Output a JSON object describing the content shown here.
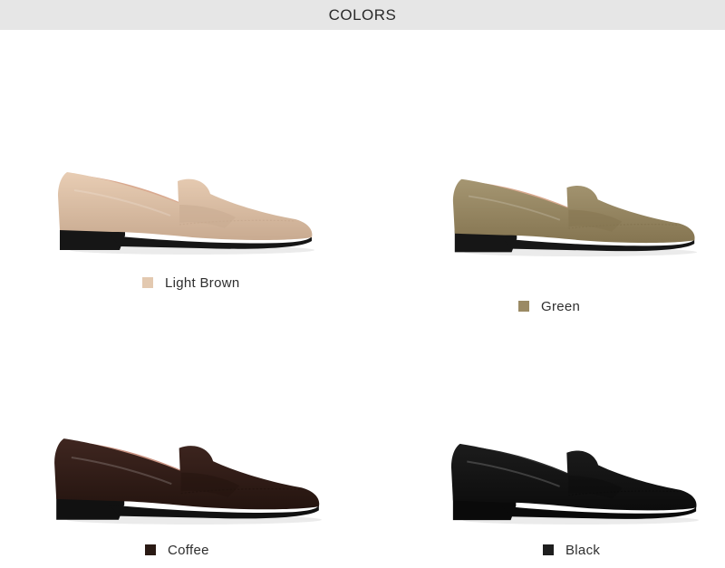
{
  "header": {
    "title": "COLORS"
  },
  "products": [
    {
      "label": "Light Brown",
      "swatch": "#e3c9b0",
      "upper": "#e8cdb4",
      "upper_dark": "#c9ab91",
      "collar": "#d9a98f",
      "sole": "#161616"
    },
    {
      "label": "Green",
      "swatch": "#9b8a64",
      "upper": "#a59672",
      "upper_dark": "#857551",
      "collar": "#d9a98f",
      "sole": "#161616"
    },
    {
      "label": "Coffee",
      "swatch": "#2a1a14",
      "upper": "#3f2620",
      "upper_dark": "#24140f",
      "collar": "#c99382",
      "sole": "#111111"
    },
    {
      "label": "Black",
      "swatch": "#1e1e1e",
      "upper": "#1c1c1c",
      "upper_dark": "#0c0c0c",
      "collar": "#2b2b2b",
      "sole": "#0a0a0a"
    }
  ]
}
